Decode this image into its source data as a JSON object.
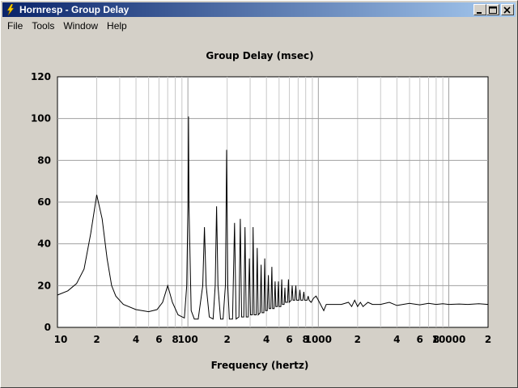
{
  "window": {
    "title": "Hornresp - Group Delay"
  },
  "menu": {
    "file": "File",
    "tools": "Tools",
    "window": "Window",
    "help": "Help"
  },
  "icons": {
    "app": "lightning-bolt-icon",
    "minimize": "minimize-icon",
    "maximize": "maximize-icon",
    "close": "close-icon"
  },
  "chart_data": {
    "type": "line",
    "title": "Group Delay (msec)",
    "xlabel": "Frequency (hertz)",
    "ylabel": "",
    "x_scale": "log",
    "xlim": [
      10,
      20000
    ],
    "ylim": [
      0,
      120
    ],
    "grid": true,
    "y_ticks": [
      "0",
      "20",
      "40",
      "60",
      "80",
      "100",
      "120"
    ],
    "x_tick_labels": [
      {
        "x": 10,
        "label": "10"
      },
      {
        "x": 20,
        "label": "2"
      },
      {
        "x": 40,
        "label": "4"
      },
      {
        "x": 60,
        "label": "6"
      },
      {
        "x": 80,
        "label": "8"
      },
      {
        "x": 100,
        "label": "100"
      },
      {
        "x": 200,
        "label": "2"
      },
      {
        "x": 400,
        "label": "4"
      },
      {
        "x": 600,
        "label": "6"
      },
      {
        "x": 800,
        "label": "8"
      },
      {
        "x": 1000,
        "label": "1000"
      },
      {
        "x": 2000,
        "label": "2"
      },
      {
        "x": 4000,
        "label": "4"
      },
      {
        "x": 6000,
        "label": "6"
      },
      {
        "x": 8000,
        "label": "8"
      },
      {
        "x": 10000,
        "label": "10000"
      },
      {
        "x": 20000,
        "label": "2"
      }
    ],
    "series": [
      {
        "values": [
          [
            10,
            15.5
          ],
          [
            12,
            17.5
          ],
          [
            14,
            21
          ],
          [
            16,
            28
          ],
          [
            18,
            45
          ],
          [
            20,
            63.5
          ],
          [
            22,
            52
          ],
          [
            24,
            33
          ],
          [
            26,
            20
          ],
          [
            28,
            15
          ],
          [
            32,
            11
          ],
          [
            40,
            8.5
          ],
          [
            50,
            7.5
          ],
          [
            58,
            8.5
          ],
          [
            64,
            12
          ],
          [
            70,
            20
          ],
          [
            76,
            12
          ],
          [
            84,
            6
          ],
          [
            94,
            4.5
          ],
          [
            98,
            20
          ],
          [
            100,
            58
          ],
          [
            101,
            101
          ],
          [
            102,
            58
          ],
          [
            106,
            8
          ],
          [
            112,
            4
          ],
          [
            120,
            4
          ],
          [
            130,
            20
          ],
          [
            134,
            48
          ],
          [
            138,
            20
          ],
          [
            146,
            5
          ],
          [
            156,
            4
          ],
          [
            162,
            20
          ],
          [
            166,
            58
          ],
          [
            170,
            20
          ],
          [
            178,
            4
          ],
          [
            186,
            4
          ],
          [
            194,
            20
          ],
          [
            198,
            85
          ],
          [
            202,
            20
          ],
          [
            208,
            4
          ],
          [
            220,
            4
          ],
          [
            228,
            50
          ],
          [
            234,
            4
          ],
          [
            246,
            5
          ],
          [
            252,
            52
          ],
          [
            258,
            5
          ],
          [
            268,
            5
          ],
          [
            274,
            48
          ],
          [
            280,
            5
          ],
          [
            290,
            5
          ],
          [
            296,
            33
          ],
          [
            302,
            6
          ],
          [
            312,
            6
          ],
          [
            316,
            48
          ],
          [
            322,
            6
          ],
          [
            334,
            6
          ],
          [
            340,
            38
          ],
          [
            346,
            6
          ],
          [
            358,
            7
          ],
          [
            364,
            30
          ],
          [
            370,
            7
          ],
          [
            382,
            7
          ],
          [
            388,
            33
          ],
          [
            394,
            8
          ],
          [
            406,
            8
          ],
          [
            414,
            25
          ],
          [
            420,
            9
          ],
          [
            432,
            9
          ],
          [
            440,
            29
          ],
          [
            446,
            9
          ],
          [
            458,
            9
          ],
          [
            466,
            22
          ],
          [
            472,
            10
          ],
          [
            486,
            10
          ],
          [
            494,
            22
          ],
          [
            500,
            10
          ],
          [
            516,
            10
          ],
          [
            524,
            23
          ],
          [
            530,
            11
          ],
          [
            546,
            11
          ],
          [
            554,
            19
          ],
          [
            560,
            12
          ],
          [
            580,
            12
          ],
          [
            590,
            23
          ],
          [
            598,
            12
          ],
          [
            620,
            13
          ],
          [
            630,
            20
          ],
          [
            640,
            13
          ],
          [
            660,
            13
          ],
          [
            672,
            20
          ],
          [
            682,
            13
          ],
          [
            710,
            13
          ],
          [
            722,
            18
          ],
          [
            734,
            13
          ],
          [
            760,
            13
          ],
          [
            774,
            17
          ],
          [
            786,
            13
          ],
          [
            820,
            13
          ],
          [
            836,
            15
          ],
          [
            850,
            13
          ],
          [
            880,
            12
          ],
          [
            920,
            14
          ],
          [
            960,
            15
          ],
          [
            1000,
            13
          ],
          [
            1100,
            8
          ],
          [
            1150,
            11
          ],
          [
            1300,
            11
          ],
          [
            1500,
            11
          ],
          [
            1700,
            12
          ],
          [
            1800,
            10
          ],
          [
            1900,
            13
          ],
          [
            2000,
            10
          ],
          [
            2100,
            12
          ],
          [
            2200,
            10
          ],
          [
            2400,
            12
          ],
          [
            2600,
            11
          ],
          [
            3000,
            11
          ],
          [
            3500,
            12
          ],
          [
            4000,
            10.5
          ],
          [
            5000,
            11.5
          ],
          [
            6000,
            10.8
          ],
          [
            7000,
            11.5
          ],
          [
            8000,
            11
          ],
          [
            9000,
            11.3
          ],
          [
            10000,
            11
          ],
          [
            12000,
            11.2
          ],
          [
            14000,
            11
          ],
          [
            17000,
            11.3
          ],
          [
            20000,
            11
          ]
        ]
      }
    ]
  }
}
